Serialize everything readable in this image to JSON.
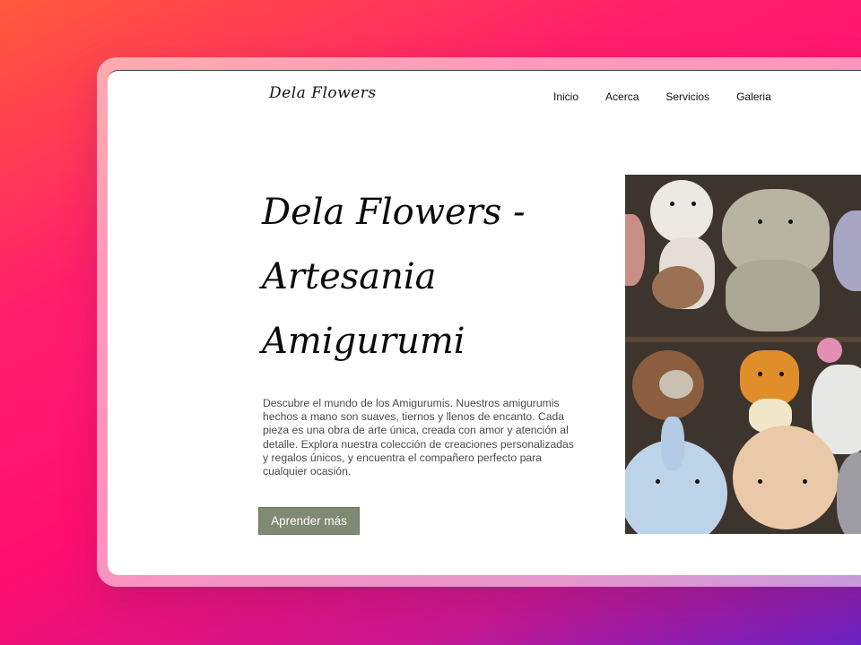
{
  "header": {
    "logo": "Dela Flowers",
    "nav": [
      "Inicio",
      "Acerca",
      "Servicios",
      "Galeria"
    ]
  },
  "hero": {
    "title": "Dela Flowers - Artesania Amigurumi",
    "description": "Descubre el mundo de los Amigurumis. Nuestros amigurumis hechos a mano son suaves, tiernos y llenos de encanto. Cada pieza es una obra de arte única, creada con amor y atención al detalle. Explora nuestra colección de creaciones personalizadas y regalos únicos, y encuentra el compañero perfecto para cualquier ocasión.",
    "cta_label": "Aprender más"
  },
  "colors": {
    "cta_background": "#7e8a72",
    "background_gradient": [
      "#ff5a3c",
      "#ff0f6e",
      "#6a22c2"
    ]
  }
}
